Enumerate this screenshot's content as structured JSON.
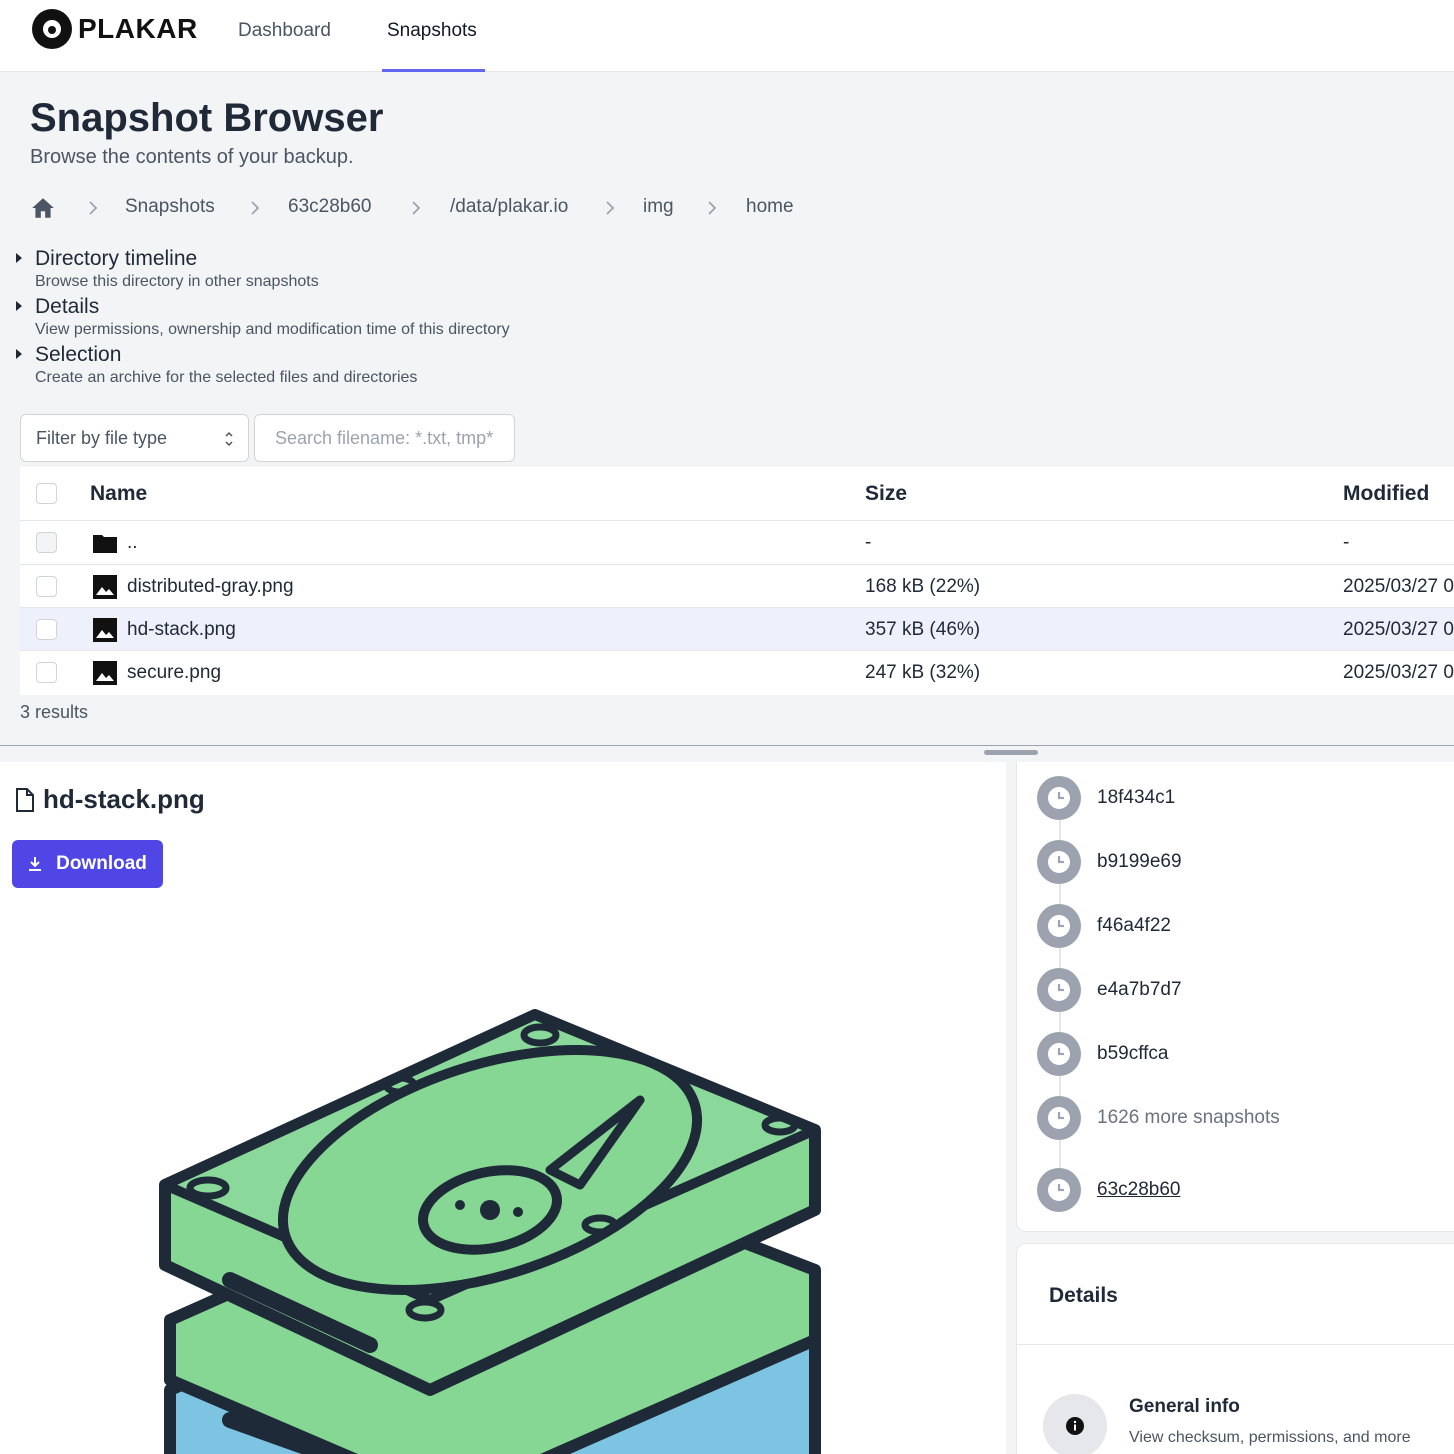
{
  "nav": {
    "brand": "PLAKAR",
    "links": [
      {
        "label": "Dashboard"
      },
      {
        "label": "Snapshots"
      }
    ]
  },
  "header": {
    "title": "Snapshot Browser",
    "subtitle": "Browse the contents of your backup."
  },
  "breadcrumb": [
    "Snapshots",
    "63c28b60",
    "/data/plakar.io",
    "img",
    "home"
  ],
  "sections": [
    {
      "title": "Directory timeline",
      "description": "Browse this directory in other snapshots"
    },
    {
      "title": "Details",
      "description": "View permissions, ownership and modification time of this directory"
    },
    {
      "title": "Selection",
      "description": "Create an archive for the selected files and directories"
    }
  ],
  "filters": {
    "type_label": "Filter by file type",
    "search_placeholder": "Search filename: *.txt, tmp*"
  },
  "table": {
    "columns": {
      "name": "Name",
      "size": "Size",
      "modified": "Modified"
    },
    "rows": [
      {
        "name": "..",
        "size": "-",
        "modified": "-",
        "icon": "folder-icon"
      },
      {
        "name": "distributed-gray.png",
        "size": "168 kB (22%)",
        "modified": "2025/03/27 0",
        "icon": "image-icon"
      },
      {
        "name": "hd-stack.png",
        "size": "357 kB (46%)",
        "modified": "2025/03/27 0",
        "icon": "image-icon"
      },
      {
        "name": "secure.png",
        "size": "247 kB (32%)",
        "modified": "2025/03/27 0",
        "icon": "image-icon"
      }
    ],
    "results": "3 results"
  },
  "preview": {
    "filename": "hd-stack.png",
    "download_label": "Download"
  },
  "timeline": {
    "items": [
      {
        "label": "18f434c1"
      },
      {
        "label": "b9199e69"
      },
      {
        "label": "f46a4f22"
      },
      {
        "label": "e4a7b7d7"
      },
      {
        "label": "b59cffca"
      },
      {
        "label": "1626 more snapshots"
      },
      {
        "label": "63c28b60"
      }
    ]
  },
  "details_card": {
    "title": "Details",
    "general_title": "General info",
    "general_desc": "View checksum, permissions, and more"
  },
  "colors": {
    "accent": "#4f46e5",
    "nav_underline": "#6366f1",
    "selected_row": "#eef0fb",
    "disk_green": "#86d694",
    "disk_blue": "#7cc4e2"
  }
}
